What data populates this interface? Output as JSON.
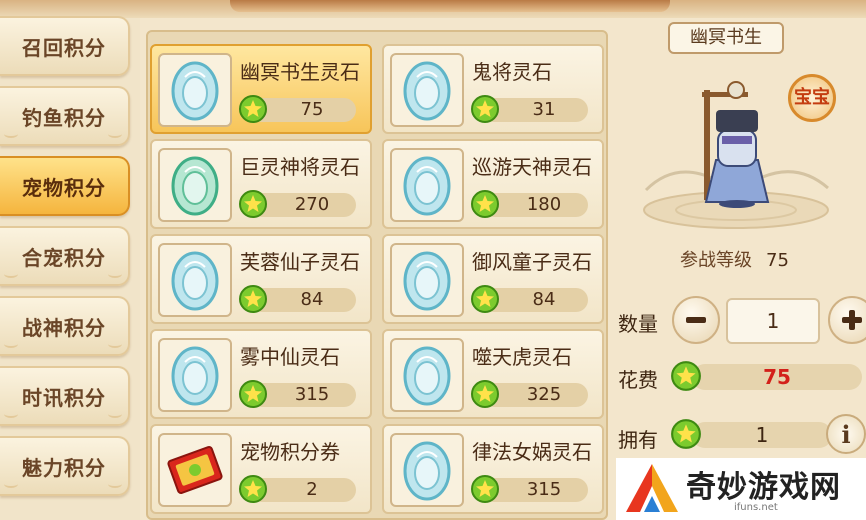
{
  "colors": {
    "accent": "#f5b53e",
    "price_red": "#d3201a",
    "brown_text": "#4a2c16"
  },
  "categories": [
    {
      "label": "召回积分",
      "active": false
    },
    {
      "label": "钓鱼积分",
      "active": false
    },
    {
      "label": "宠物积分",
      "active": true
    },
    {
      "label": "合宠积分",
      "active": false
    },
    {
      "label": "战神积分",
      "active": false
    },
    {
      "label": "时讯积分",
      "active": false
    },
    {
      "label": "魅力积分",
      "active": false
    }
  ],
  "items": [
    {
      "name": "幽冥书生灵石",
      "price": "75",
      "icon": "spirit-egg-icon"
    },
    {
      "name": "鬼将灵石",
      "price": "31",
      "icon": "spirit-egg-icon"
    },
    {
      "name": "巨灵神将灵石",
      "price": "270",
      "icon": "spirit-egg-icon"
    },
    {
      "name": "巡游天神灵石",
      "price": "180",
      "icon": "spirit-egg-icon"
    },
    {
      "name": "芙蓉仙子灵石",
      "price": "84",
      "icon": "spirit-egg-icon"
    },
    {
      "name": "御风童子灵石",
      "price": "84",
      "icon": "spirit-egg-icon"
    },
    {
      "name": "雾中仙灵石",
      "price": "315",
      "icon": "spirit-egg-icon"
    },
    {
      "name": "噬天虎灵石",
      "price": "325",
      "icon": "spirit-egg-icon"
    },
    {
      "name": "宠物积分券",
      "price": "2",
      "icon": "ticket-icon"
    },
    {
      "name": "律法女娲灵石",
      "price": "315",
      "icon": "spirit-egg-icon"
    }
  ],
  "detail": {
    "pet_name": "幽冥书生",
    "badge": "宝宝",
    "level_label": "参战等级",
    "level_value": "75",
    "quantity_label": "数量",
    "quantity_value": "1",
    "cost_label": "花费",
    "cost_value": "75",
    "owned_label": "拥有",
    "owned_value": "1",
    "info_symbol": "i"
  },
  "watermark": {
    "text": "奇妙游戏网",
    "url": "ifuns.net"
  }
}
